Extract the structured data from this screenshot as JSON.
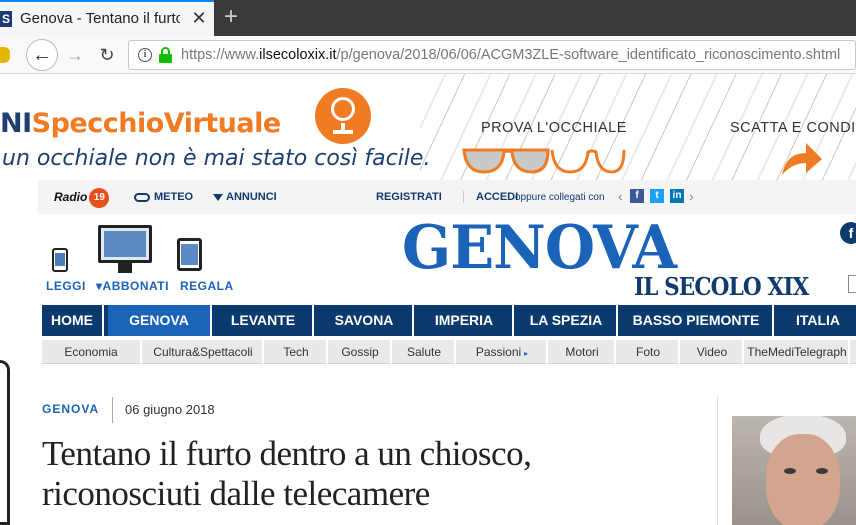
{
  "browser": {
    "tab_title": "Genova - Tentano il furto",
    "tab_favicon": "S",
    "tab_close": "✕",
    "new_tab": "+",
    "url_prefix": "https://www.",
    "url_domain": "ilsecoloxix.it",
    "url_path": "/p/genova/2018/06/06/ACGM3ZLE-software_identificato_riconoscimento.shtml",
    "back_icon": "←",
    "forward_icon": "→",
    "reload_icon": "↻",
    "info_icon": "i"
  },
  "ad": {
    "brand_prefix": "NI",
    "brand_name": "SpecchioVirtuale",
    "slogan": "un occhiale non è mai stato così facile.",
    "try_label": "PROVA L'OCCHIALE",
    "shoot_label": "SCATTA E CONDIVIDI",
    "accent_color": "#f07b22",
    "brand_color": "#1f3f70"
  },
  "topbar": {
    "radio_label": "Radio",
    "radio_number": "19",
    "meteo": "METEO",
    "annunci": "ANNUNCI",
    "registrati": "REGISTRATI",
    "accedi": "ACCEDI",
    "social_text": "oppure collegati con",
    "social_prev": "‹",
    "social_next": "›",
    "fb": "f",
    "tw": "t",
    "in": "in",
    "fb_round": "f"
  },
  "devices": {
    "leggi": "LEGGI",
    "abbonati": "▾ABBONATI",
    "regala": "REGALA"
  },
  "masthead": {
    "city": "GENOVA",
    "paper": "IL SECOLO XIX",
    "color": "#1a63b8"
  },
  "main_nav": [
    {
      "label": "HOME",
      "active": false
    },
    {
      "label": "GENOVA",
      "active": true
    },
    {
      "label": "LEVANTE",
      "active": false
    },
    {
      "label": "SAVONA",
      "active": false
    },
    {
      "label": "IMPERIA",
      "active": false
    },
    {
      "label": "LA SPEZIA",
      "active": false
    },
    {
      "label": "BASSO PIEMONTE",
      "active": false
    },
    {
      "label": "ITALIA",
      "active": false
    }
  ],
  "sub_nav": [
    {
      "label": "Economia"
    },
    {
      "label": "Cultura&Spettacoli"
    },
    {
      "label": "Tech"
    },
    {
      "label": "Gossip"
    },
    {
      "label": "Salute"
    },
    {
      "label": "Passioni",
      "arrow": "▸"
    },
    {
      "label": "Motori"
    },
    {
      "label": "Foto"
    },
    {
      "label": "Video"
    },
    {
      "label": "TheMediTelegraph"
    }
  ],
  "article": {
    "section": "GENOVA",
    "date": "06 giugno 2018",
    "title": "Tentano il furto dentro a un chiosco, riconosciuti dalle telecamere"
  },
  "colors": {
    "nav_bg": "#0b3a6e",
    "nav_active": "#1a63b8",
    "link_blue": "#1a63b8"
  }
}
